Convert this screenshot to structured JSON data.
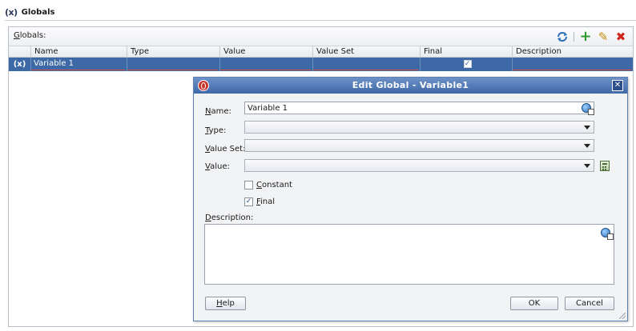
{
  "page": {
    "icon": "(x)",
    "title": "Globals"
  },
  "panel": {
    "label_key": "G",
    "label_rest": "lobals:",
    "toolbar": {
      "refresh_icon": "refresh-icon",
      "add_symbol": "+",
      "edit_symbol": "✎",
      "delete_symbol": "✖",
      "colors": {
        "add": "#2f9a2f",
        "edit": "#c88a10",
        "delete": "#d0241c"
      }
    }
  },
  "table": {
    "columns": [
      "Name",
      "Type",
      "Value",
      "Value Set",
      "Final",
      "Description"
    ],
    "rows": [
      {
        "icon": "(x)",
        "name": "Variable 1",
        "type": "",
        "value": "",
        "value_set": "",
        "final": "✓",
        "description": ""
      }
    ]
  },
  "dialog": {
    "title": "Edit Global - Variable1",
    "close_symbol": "✕",
    "name": {
      "key": "N",
      "rest": "ame:",
      "value": "Variable 1"
    },
    "type": {
      "key": "T",
      "rest": "ype:"
    },
    "value_set": {
      "key": "V",
      "rest": "alue Set:"
    },
    "value": {
      "key": "V",
      "rest": "alue:"
    },
    "constant": {
      "key": "C",
      "rest": "onstant",
      "checked": ""
    },
    "final": {
      "key": "F",
      "rest": "inal",
      "checked": "✓"
    },
    "description": {
      "key": "D",
      "rest": "escription:"
    },
    "buttons": {
      "help_key": "H",
      "help_rest": "elp",
      "ok": "OK",
      "cancel": "Cancel"
    }
  }
}
